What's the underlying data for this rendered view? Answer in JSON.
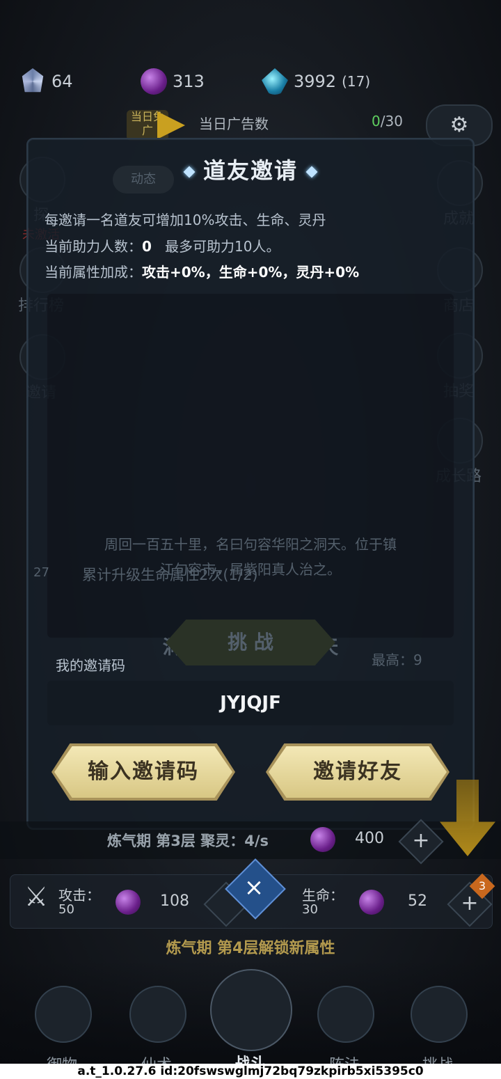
{
  "resources": {
    "crystal": "64",
    "orb": "313",
    "power": "3992",
    "power_sub": "(17)"
  },
  "ad": {
    "badge": "当日免广",
    "label": "当日广告数",
    "count_current": "0",
    "count_total": "/30"
  },
  "side_left": [
    {
      "label": "探",
      "sub": "未激活"
    },
    {
      "label": "排行榜"
    },
    {
      "label": "邀请"
    }
  ],
  "side_right": [
    {
      "label": "成就"
    },
    {
      "label": "商店"
    },
    {
      "label": "抽奖"
    },
    {
      "label": "成长路"
    }
  ],
  "bg": {
    "dynamic": "动态",
    "task": "累计升级生命属性2次(1/2)",
    "task_num": "27",
    "cave_title": "洞天一 句容华阳之天",
    "cave_desc1": "周回一百五十里，名曰句容华阳之洞天。位于镇",
    "cave_desc2": "江句容市，属紫阳真人治之。",
    "challenge": "挑 战",
    "best": "最高：9"
  },
  "modal": {
    "title": "道友邀请",
    "line1": "每邀请一名道友可增加10%攻击、生命、灵丹",
    "line2_label": "当前助力人数：",
    "line2_value": "0",
    "line2_max": "最多可助力10人。",
    "line3_label": "当前属性加成：",
    "line3_value": "攻击+0%，生命+0%，灵丹+0%",
    "code_label": "我的邀请码",
    "code": "JYJQJF",
    "btn_enter": "输入邀请码",
    "btn_invite": "邀请好友",
    "close": "×"
  },
  "cultivation": {
    "level": "炼气期 第3层 聚灵：4/s",
    "cost": "400"
  },
  "stats": {
    "atk_label": "攻击：",
    "atk_value": "50",
    "atk_cost": "108",
    "hp_label": "生命：",
    "hp_value": "30",
    "hp_cost": "52",
    "badge": "3"
  },
  "unlock_text": "炼气期 第4层解锁新属性",
  "nav": [
    "御物",
    "仙术",
    "战斗",
    "阵法",
    "挑战"
  ],
  "footer": "a.t_1.0.27.6 id:20fswswglmj72bq79zkpirb5xi5395c0"
}
